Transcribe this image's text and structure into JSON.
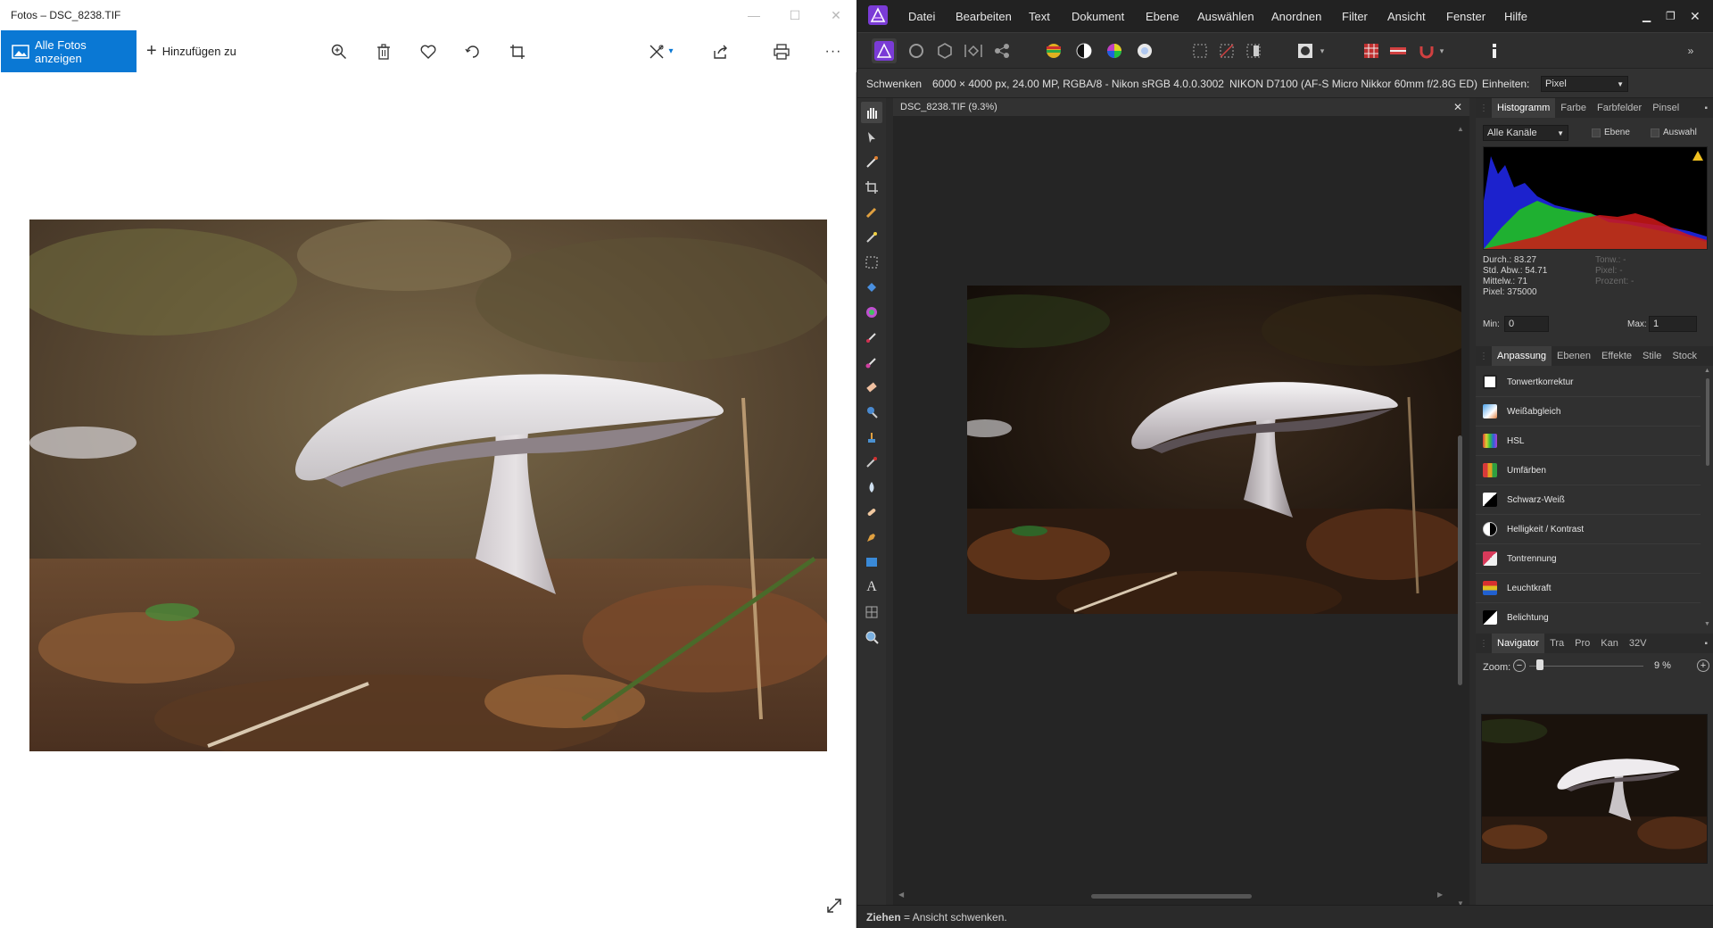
{
  "photos": {
    "title": "Fotos – DSC_8238.TIF",
    "all_photos_label": "Alle Fotos anzeigen",
    "add_to_label": "Hinzufügen zu",
    "toolbar_icons": [
      "zoom-icon",
      "delete-icon",
      "favorite-icon",
      "rotate-icon",
      "crop-icon",
      "edit-icon",
      "share-icon",
      "print-icon",
      "more-icon"
    ]
  },
  "affinity": {
    "menu": [
      "Datei",
      "Bearbeiten",
      "Text",
      "Dokument",
      "Ebene",
      "Auswählen",
      "Anordnen",
      "Filter",
      "Ansicht",
      "Fenster",
      "Hilfe"
    ],
    "context": {
      "tool": "Schwenken",
      "info": "6000 × 4000 px, 24.00 MP, RGBA/8 - Nikon sRGB 4.0.0.3002",
      "camera": "NIKON D7100 (AF-S Micro Nikkor 60mm f/2.8G ED)",
      "units_label": "Einheiten:",
      "units_value": "Pixel"
    },
    "doc_tab": "DSC_8238.TIF (9.3%)",
    "histogram": {
      "tabs": [
        "Histogramm",
        "Farbe",
        "Farbfelder",
        "Pinsel"
      ],
      "channel": "Alle Kanäle",
      "layer_label": "Ebene",
      "selection_label": "Auswahl",
      "stats": [
        {
          "label": "Durch.:",
          "value": "83.27"
        },
        {
          "label": "Std. Abw.:",
          "value": "54.71"
        },
        {
          "label": "Mittelw.:",
          "value": "71"
        },
        {
          "label": "Pixel:",
          "value": "375000"
        }
      ],
      "dim_stats": [
        "Tonw.: -",
        "Pixel: -",
        "Prozent: -"
      ],
      "min_label": "Min:",
      "min_value": "0",
      "max_label": "Max:",
      "max_value": "1"
    },
    "adjustments": {
      "tabs": [
        "Anpassung",
        "Ebenen",
        "Effekte",
        "Stile",
        "Stock"
      ],
      "items": [
        {
          "label": "Tonwertkorrektur",
          "color": "#222222"
        },
        {
          "label": "Weißabgleich",
          "color": "#4aa0e8"
        },
        {
          "label": "HSL",
          "color": "#b04ad8"
        },
        {
          "label": "Umfärben",
          "color": "#d88a2a"
        },
        {
          "label": "Schwarz-Weiß",
          "color": "#ffffff"
        },
        {
          "label": "Helligkeit / Kontrast",
          "color": "#ffffff"
        },
        {
          "label": "Tontrennung",
          "color": "#d83a5a"
        },
        {
          "label": "Leuchtkraft",
          "color": "#e0a020"
        },
        {
          "label": "Belichtung",
          "color": "#ffffff"
        }
      ]
    },
    "navigator": {
      "tabs": [
        "Navigator",
        "Tra",
        "Pro",
        "Kan",
        "32V"
      ],
      "zoom_label": "Zoom:",
      "zoom_value": "9 %"
    },
    "status": {
      "key": "Ziehen",
      "text": " = Ansicht schwenken."
    },
    "colors": {
      "accent": "#0a78d4",
      "affinity_purple": "#7a3bd6"
    }
  }
}
